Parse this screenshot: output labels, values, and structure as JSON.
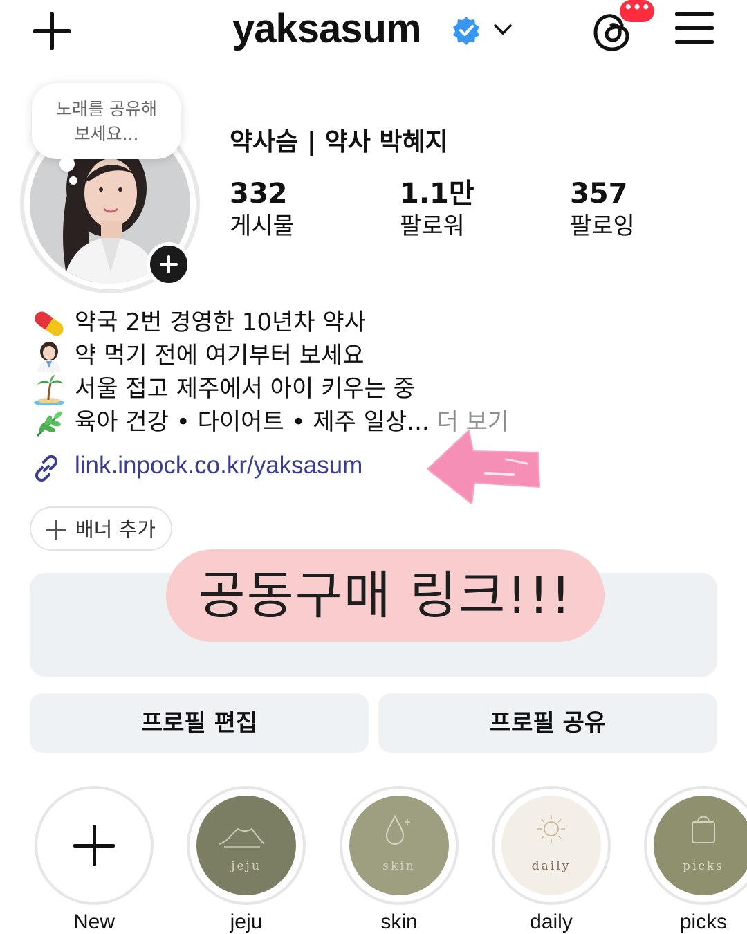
{
  "header": {
    "username": "yaksasum",
    "threads_badge": "•••",
    "colors": {
      "verified": "#3797f0",
      "badge": "#ff2d3f"
    }
  },
  "profile": {
    "note": "노래를 공유해 보세요...",
    "display_name": "약사슴 | 약사 박혜지",
    "stats": [
      {
        "value": "332",
        "label": "게시물"
      },
      {
        "value": "1.1만",
        "label": "팔로워"
      },
      {
        "value": "357",
        "label": "팔로잉"
      }
    ]
  },
  "bio": {
    "lines": [
      {
        "icon": "pill-emoji",
        "text": "약국 2번 경영한 10년차 약사"
      },
      {
        "icon": "pharmacist-emoji",
        "text": "약 먹기 전에 여기부터 보세요"
      },
      {
        "icon": "island-emoji",
        "text": "서울 접고 제주에서 아이 키우는 중"
      },
      {
        "icon": "herb-emoji",
        "text": "육아 건강 • 다이어트 • 제주 일상...",
        "more": "더 보기"
      }
    ],
    "link": "link.inpock.co.kr/yaksasum"
  },
  "banner_add_label": "배너 추가",
  "overlay_caption": "공동구매 링크!!!",
  "buttons": {
    "edit_profile": "프로필 편집",
    "share_profile": "프로필 공유"
  },
  "highlights": [
    {
      "label": "New",
      "cover": ""
    },
    {
      "label": "jeju",
      "cover": "jeju"
    },
    {
      "label": "skin",
      "cover": "skin"
    },
    {
      "label": "daily",
      "cover": "daily"
    },
    {
      "label": "picks",
      "cover": "picks"
    }
  ]
}
